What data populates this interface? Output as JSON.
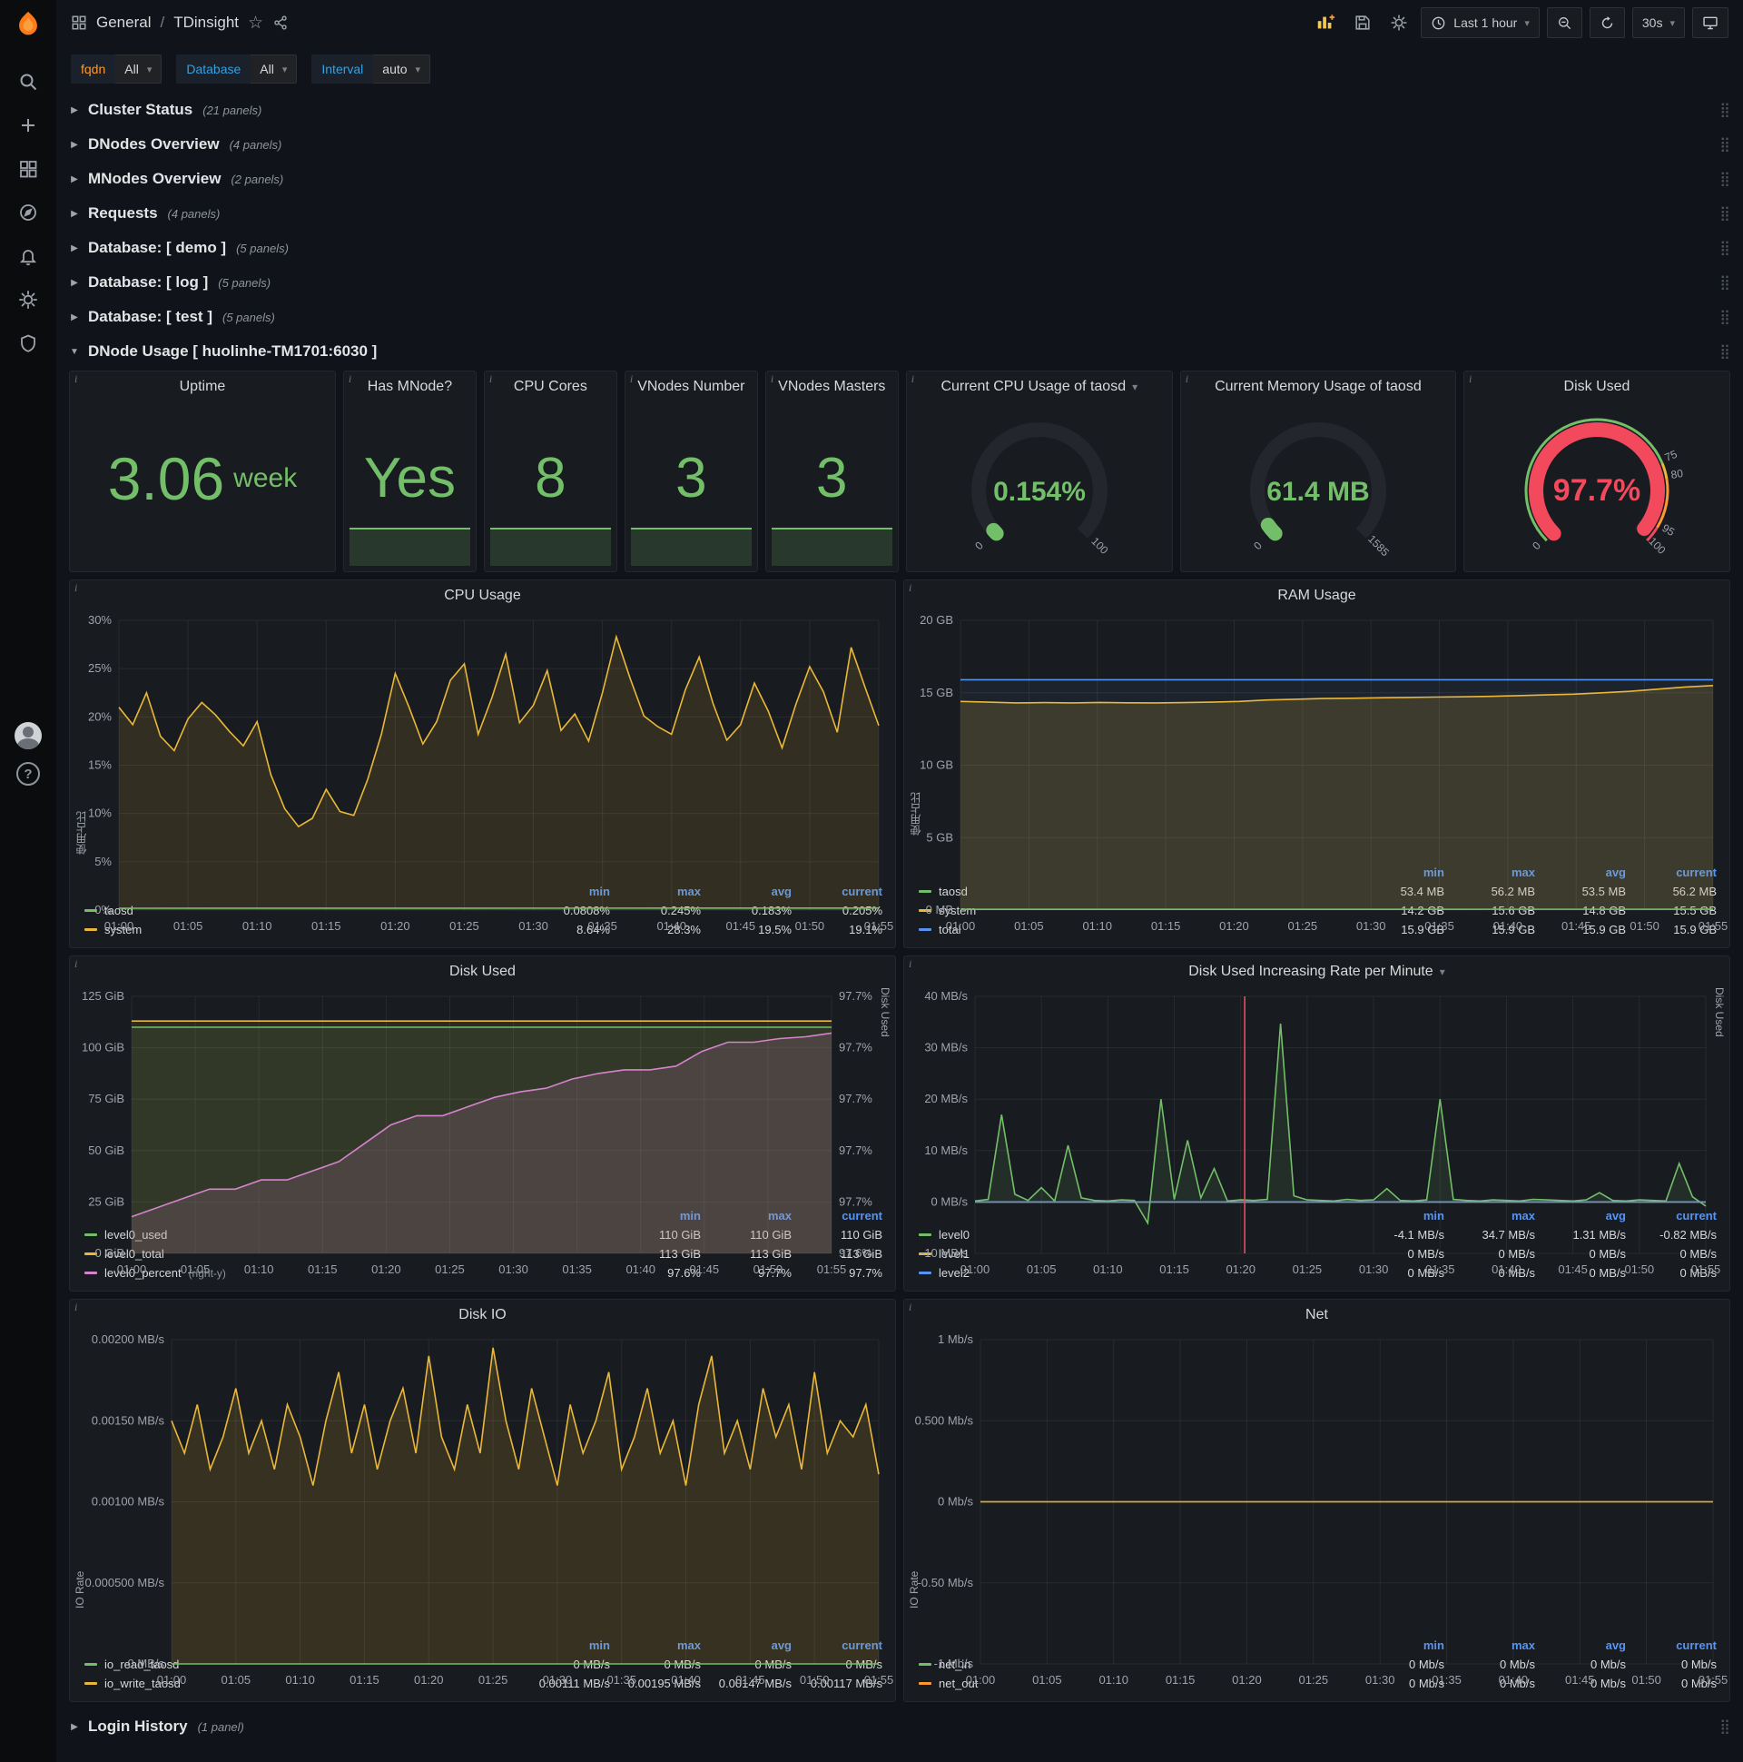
{
  "icons": {
    "chevron_down": "▾",
    "chevron_right": "▶",
    "chevron_expanded": "▼",
    "drag": "⣿",
    "star": "☆",
    "info": "i",
    "question": "?"
  },
  "topbar": {
    "folder": "General",
    "sep": "/",
    "title": "TDinsight",
    "time_label": "Last 1 hour",
    "interval_label": "30s"
  },
  "variables": [
    {
      "label": "fqdn",
      "value": "All",
      "label_color": "#ff9830"
    },
    {
      "label": "Database",
      "value": "All",
      "label_color": "#33a2e5"
    },
    {
      "label": "Interval",
      "value": "auto",
      "label_color": "#33a2e5"
    }
  ],
  "rows": [
    {
      "title": "Cluster Status",
      "count": "(21 panels)"
    },
    {
      "title": "DNodes Overview",
      "count": "(4 panels)"
    },
    {
      "title": "MNodes Overview",
      "count": "(2 panels)"
    },
    {
      "title": "Requests",
      "count": "(4 panels)"
    },
    {
      "title": "Database: [ demo ]",
      "count": "(5 panels)"
    },
    {
      "title": "Database: [ log ]",
      "count": "(5 panels)"
    },
    {
      "title": "Database: [ test ]",
      "count": "(5 panels)"
    }
  ],
  "expanded_row_title": "DNode Usage [ huolinhe-TM1701:6030 ]",
  "bottom_row": {
    "title": "Login History",
    "count": "(1 panel)"
  },
  "stats": [
    {
      "title": "Uptime",
      "value": "3.06",
      "unit": "week"
    },
    {
      "title": "Has MNode?",
      "value": "Yes"
    },
    {
      "title": "CPU Cores",
      "value": "8"
    },
    {
      "title": "VNodes Number",
      "value": "3"
    },
    {
      "title": "VNodes Masters",
      "value": "3"
    }
  ],
  "gauges": [
    {
      "title": "Current CPU Usage of taosd",
      "caret": true,
      "value": 0.154,
      "min": 0,
      "max": 100,
      "display": "0.154%",
      "color": "#73bf69",
      "font": 30,
      "min_label": "0",
      "max_label": "100"
    },
    {
      "title": "Current Memory Usage of taosd",
      "value": 61.4,
      "min": 0,
      "max": 1585,
      "display": "61.4 MB",
      "color": "#73bf69",
      "font": 30,
      "min_label": "0",
      "max_label": "1585"
    },
    {
      "title": "Disk Used",
      "value": 97.7,
      "min": 0,
      "max": 100,
      "display": "97.7%",
      "color": "#f2495c",
      "font": 34,
      "thresholds": [
        {
          "v": 0,
          "t": "0",
          "color": "#73bf69"
        },
        {
          "v": 75,
          "t": "75",
          "color": "#eab839"
        },
        {
          "v": 80,
          "t": "80",
          "color": "#ff9830"
        },
        {
          "v": 95,
          "t": "95",
          "color": "#f2495c"
        },
        {
          "v": 100,
          "t": "100",
          "color": "#f2495c"
        }
      ]
    }
  ],
  "chart_data": [
    {
      "id": "cpu-usage",
      "type": "line",
      "title": "CPU Usage",
      "y_label": "使用占比",
      "pad_left": 54,
      "ylim": [
        0,
        30
      ],
      "y_ticks": [
        {
          "v": 0,
          "t": "0%"
        },
        {
          "v": 5,
          "t": "5%"
        },
        {
          "v": 10,
          "t": "10%"
        },
        {
          "v": 15,
          "t": "15%"
        },
        {
          "v": 20,
          "t": "20%"
        },
        {
          "v": 25,
          "t": "25%"
        },
        {
          "v": 30,
          "t": "30%"
        }
      ],
      "x_ticks": [
        "01:00",
        "01:05",
        "01:10",
        "01:15",
        "01:20",
        "01:25",
        "01:30",
        "01:35",
        "01:40",
        "01:45",
        "01:50",
        "01:55"
      ],
      "series": [
        {
          "name": "system",
          "color": "#eab839",
          "fill": 0.13,
          "values": [
            21.0,
            19.2,
            22.5,
            18.0,
            16.5,
            19.8,
            21.5,
            20.2,
            18.5,
            17.0,
            19.5,
            14.0,
            10.5,
            8.64,
            9.5,
            12.5,
            10.2,
            9.8,
            13.5,
            18.2,
            24.5,
            21.0,
            17.2,
            19.5,
            23.8,
            25.5,
            18.2,
            22.0,
            26.5,
            19.4,
            21.2,
            24.8,
            18.6,
            20.3,
            17.5,
            22.5,
            28.3,
            24.0,
            20.1,
            19.0,
            18.2,
            22.8,
            26.2,
            21.4,
            17.6,
            19.2,
            23.5,
            20.6,
            16.8,
            21.3,
            25.2,
            22.6,
            18.4,
            27.2,
            23.1,
            19.1
          ]
        },
        {
          "name": "taosd",
          "color": "#73bf69",
          "fill": 0.1,
          "values": [
            0.19,
            0.205
          ]
        }
      ],
      "legend": {
        "headers": [
          "min",
          "max",
          "avg",
          "current"
        ],
        "rows": [
          {
            "name": "taosd",
            "color": "#73bf69",
            "values": [
              "0.0808%",
              "0.245%",
              "0.183%",
              "0.205%"
            ]
          },
          {
            "name": "system",
            "color": "#eab839",
            "values": [
              "8.64%",
              "28.3%",
              "19.5%",
              "19.1%"
            ]
          }
        ]
      }
    },
    {
      "id": "ram-usage",
      "type": "line",
      "title": "RAM Usage",
      "y_label": "使用占比",
      "pad_left": 62,
      "ylim": [
        0,
        20
      ],
      "y_ticks": [
        {
          "v": 0,
          "t": "0 MB"
        },
        {
          "v": 5,
          "t": "5 GB"
        },
        {
          "v": 10,
          "t": "10 GB"
        },
        {
          "v": 15,
          "t": "15 GB"
        },
        {
          "v": 20,
          "t": "20 GB"
        }
      ],
      "x_ticks": [
        "01:00",
        "01:05",
        "01:10",
        "01:15",
        "01:20",
        "01:25",
        "01:30",
        "01:35",
        "01:40",
        "01:45",
        "01:50",
        "01:55"
      ],
      "series": [
        {
          "name": "total",
          "color": "#5794f2",
          "fill": 0.07,
          "values": [
            15.9,
            15.9
          ]
        },
        {
          "name": "system",
          "color": "#eab839",
          "fill": 0.16,
          "values": [
            14.4,
            14.35,
            14.3,
            14.32,
            14.3,
            14.33,
            14.31,
            14.3,
            14.32,
            14.35,
            14.4,
            14.5,
            14.55,
            14.6,
            14.62,
            14.65,
            14.68,
            14.7,
            14.72,
            14.75,
            14.8,
            14.85,
            14.9,
            15.0,
            15.1,
            15.25,
            15.4,
            15.5
          ]
        },
        {
          "name": "taosd",
          "color": "#73bf69",
          "fill": 0.1,
          "values": [
            0.053,
            0.055
          ]
        }
      ],
      "legend": {
        "headers": [
          "min",
          "max",
          "avg",
          "current"
        ],
        "rows": [
          {
            "name": "taosd",
            "color": "#73bf69",
            "values": [
              "53.4 MB",
              "56.2 MB",
              "53.5 MB",
              "56.2 MB"
            ]
          },
          {
            "name": "system",
            "color": "#eab839",
            "values": [
              "14.2 GB",
              "15.6 GB",
              "14.8 GB",
              "15.5 GB"
            ]
          },
          {
            "name": "total",
            "color": "#5794f2",
            "values": [
              "15.9 GB",
              "15.9 GB",
              "15.9 GB",
              "15.9 GB"
            ]
          }
        ]
      }
    },
    {
      "id": "disk-used",
      "type": "line",
      "title": "Disk Used",
      "pad_left": 68,
      "ylim": [
        0,
        125
      ],
      "right_lim": [
        97.58,
        97.72
      ],
      "right_label": "Disk Used",
      "y_ticks": [
        {
          "v": 0,
          "t": "0 GiB"
        },
        {
          "v": 25,
          "t": "25 GiB"
        },
        {
          "v": 50,
          "t": "50 GiB"
        },
        {
          "v": 75,
          "t": "75 GiB"
        },
        {
          "v": 100,
          "t": "100 GiB"
        },
        {
          "v": 125,
          "t": "125 GiB"
        }
      ],
      "right_ticks": [
        "97.6%",
        "97.7%",
        "97.7%",
        "97.7%",
        "97.7%",
        "97.7%"
      ],
      "x_ticks": [
        "01:00",
        "01:05",
        "01:10",
        "01:15",
        "01:20",
        "01:25",
        "01:30",
        "01:35",
        "01:40",
        "01:45",
        "01:50",
        "01:55"
      ],
      "series": [
        {
          "name": "level0_total",
          "color": "#eab839",
          "fill": 0.1,
          "values": [
            113,
            113
          ]
        },
        {
          "name": "level0_used",
          "color": "#73bf69",
          "fill": 0.09,
          "values": [
            110,
            110
          ]
        },
        {
          "name": "level0_percent",
          "color": "#d683ce",
          "axis": "right",
          "fill": 0.16,
          "values": [
            97.6,
            97.605,
            97.61,
            97.615,
            97.615,
            97.62,
            97.62,
            97.625,
            97.63,
            97.64,
            97.65,
            97.655,
            97.655,
            97.66,
            97.665,
            97.668,
            97.67,
            97.675,
            97.678,
            97.68,
            97.68,
            97.682,
            97.69,
            97.695,
            97.695,
            97.697,
            97.698,
            97.7
          ]
        }
      ],
      "legend": {
        "headers": [
          "min",
          "max",
          "current"
        ],
        "rows": [
          {
            "name": "level0_used",
            "color": "#73bf69",
            "values": [
              "110 GiB",
              "110 GiB",
              "110 GiB"
            ]
          },
          {
            "name": "level0_total",
            "color": "#eab839",
            "values": [
              "113 GiB",
              "113 GiB",
              "113 GiB"
            ]
          },
          {
            "name": "level0_percent",
            "color": "#d683ce",
            "note": "(right-y)",
            "values": [
              "97.6%",
              "97.7%",
              "97.7%"
            ]
          }
        ]
      }
    },
    {
      "id": "disk-rate",
      "type": "line",
      "title": "Disk Used Increasing Rate per Minute",
      "caret": true,
      "pad_left": 78,
      "ylim": [
        -10,
        40
      ],
      "right_label": "Disk Used",
      "vline": 20.3,
      "y_ticks": [
        {
          "v": -10,
          "t": "-10 MB/s"
        },
        {
          "v": 0,
          "t": "0 MB/s"
        },
        {
          "v": 10,
          "t": "10 MB/s"
        },
        {
          "v": 20,
          "t": "20 MB/s"
        },
        {
          "v": 30,
          "t": "30 MB/s"
        },
        {
          "v": 40,
          "t": "40 MB/s"
        }
      ],
      "x_ticks": [
        "01:00",
        "01:05",
        "01:10",
        "01:15",
        "01:20",
        "01:25",
        "01:30",
        "01:35",
        "01:40",
        "01:45",
        "01:50",
        "01:55"
      ],
      "series": [
        {
          "name": "level0",
          "color": "#73bf69",
          "fill": 0.12,
          "values": [
            0.2,
            0.5,
            17,
            1.5,
            0.3,
            2.8,
            0.2,
            11,
            0.8,
            0.3,
            0.2,
            0.4,
            0.3,
            -4.1,
            20,
            0.5,
            12,
            0.8,
            6.5,
            0.2,
            0.4,
            0.3,
            0.5,
            34.7,
            1.2,
            0.4,
            0.3,
            0.2,
            0.5,
            0.3,
            0.4,
            2.6,
            0.3,
            0.2,
            0.4,
            20,
            0.5,
            0.3,
            0.2,
            0.4,
            0.3,
            0.2,
            0.5,
            0.4,
            0.3,
            0.2,
            0.4,
            1.8,
            0.3,
            0.2,
            0.4,
            0.3,
            0.2,
            7.5,
            1.0,
            -0.82
          ]
        },
        {
          "name": "level1",
          "color": "#eab839",
          "values": [
            0,
            0
          ]
        },
        {
          "name": "level2",
          "color": "#5794f2",
          "values": [
            0,
            0
          ]
        }
      ],
      "legend": {
        "headers": [
          "min",
          "max",
          "avg",
          "current"
        ],
        "rows": [
          {
            "name": "level0",
            "color": "#73bf69",
            "values": [
              "-4.1 MB/s",
              "34.7 MB/s",
              "1.31 MB/s",
              "-0.82 MB/s"
            ]
          },
          {
            "name": "level1",
            "color": "#eab839",
            "values": [
              "0 MB/s",
              "0 MB/s",
              "0 MB/s",
              "0 MB/s"
            ]
          },
          {
            "name": "level2",
            "color": "#5794f2",
            "values": [
              "0 MB/s",
              "0 MB/s",
              "0 MB/s",
              "0 MB/s"
            ]
          }
        ]
      }
    },
    {
      "id": "disk-io",
      "type": "line",
      "title": "Disk IO",
      "y_label": "IO Rate",
      "pad_left": 112,
      "ylim": [
        0,
        0.002
      ],
      "y_ticks": [
        {
          "v": 0,
          "t": "0 MB/s"
        },
        {
          "v": 0.0005,
          "t": "0.000500 MB/s"
        },
        {
          "v": 0.001,
          "t": "0.00100 MB/s"
        },
        {
          "v": 0.0015,
          "t": "0.00150 MB/s"
        },
        {
          "v": 0.002,
          "t": "0.00200 MB/s"
        }
      ],
      "x_ticks": [
        "01:00",
        "01:05",
        "01:10",
        "01:15",
        "01:20",
        "01:25",
        "01:30",
        "01:35",
        "01:40",
        "01:45",
        "01:50",
        "01:55"
      ],
      "series": [
        {
          "name": "io_write_taosd",
          "color": "#eab839",
          "fill": 0.15,
          "values": [
            0.0015,
            0.0013,
            0.0016,
            0.0012,
            0.0014,
            0.0017,
            0.0013,
            0.0015,
            0.0012,
            0.0016,
            0.0014,
            0.0011,
            0.0015,
            0.0018,
            0.0013,
            0.0016,
            0.0012,
            0.0015,
            0.0017,
            0.0013,
            0.0019,
            0.0014,
            0.0012,
            0.0016,
            0.0013,
            0.00195,
            0.0015,
            0.0012,
            0.0017,
            0.0014,
            0.0011,
            0.0016,
            0.0013,
            0.0015,
            0.0018,
            0.0012,
            0.0014,
            0.0017,
            0.0013,
            0.0015,
            0.0011,
            0.0016,
            0.0019,
            0.0013,
            0.0015,
            0.0012,
            0.0017,
            0.0014,
            0.0016,
            0.0012,
            0.0018,
            0.0013,
            0.0015,
            0.0014,
            0.0016,
            0.00117
          ]
        },
        {
          "name": "io_read_taosd",
          "color": "#73bf69",
          "fill": 0.08,
          "values": [
            0,
            0
          ]
        }
      ],
      "legend": {
        "headers": [
          "min",
          "max",
          "avg",
          "current"
        ],
        "rows": [
          {
            "name": "io_read_taosd",
            "color": "#73bf69",
            "values": [
              "0 MB/s",
              "0 MB/s",
              "0 MB/s",
              "0 MB/s"
            ]
          },
          {
            "name": "io_write_taosd",
            "color": "#eab839",
            "values": [
              "0.00111 MB/s",
              "0.00195 MB/s",
              "0.00147 MB/s",
              "0.00117 MB/s"
            ]
          }
        ]
      }
    },
    {
      "id": "net",
      "type": "line",
      "title": "Net",
      "y_label": "IO Rate",
      "pad_left": 84,
      "ylim": [
        -1,
        1
      ],
      "y_ticks": [
        {
          "v": -1,
          "t": "-1 Mb/s"
        },
        {
          "v": -0.5,
          "t": "-0.50 Mb/s"
        },
        {
          "v": 0,
          "t": "0 Mb/s"
        },
        {
          "v": 0.5,
          "t": "0.500 Mb/s"
        },
        {
          "v": 1,
          "t": "1 Mb/s"
        }
      ],
      "x_ticks": [
        "01:00",
        "01:05",
        "01:10",
        "01:15",
        "01:20",
        "01:25",
        "01:30",
        "01:35",
        "01:40",
        "01:45",
        "01:50",
        "01:55"
      ],
      "series": [
        {
          "name": "net_in",
          "color": "#73bf69",
          "values": [
            0,
            0
          ]
        },
        {
          "name": "net_out",
          "color": "#ff9830",
          "values": [
            0,
            0
          ]
        }
      ],
      "legend": {
        "headers": [
          "min",
          "max",
          "avg",
          "current"
        ],
        "rows": [
          {
            "name": "net_in",
            "color": "#73bf69",
            "values": [
              "0 Mb/s",
              "0 Mb/s",
              "0 Mb/s",
              "0 Mb/s"
            ]
          },
          {
            "name": "net_out",
            "color": "#ff9830",
            "values": [
              "0 Mb/s",
              "0 Mb/s",
              "0 Mb/s",
              "0 Mb/s"
            ]
          }
        ]
      }
    }
  ],
  "colors": {
    "green": "#73bf69",
    "yellow": "#eab839",
    "blue": "#5794f2",
    "pink": "#d683ce",
    "orange": "#ff9830",
    "red": "#f2495c"
  }
}
